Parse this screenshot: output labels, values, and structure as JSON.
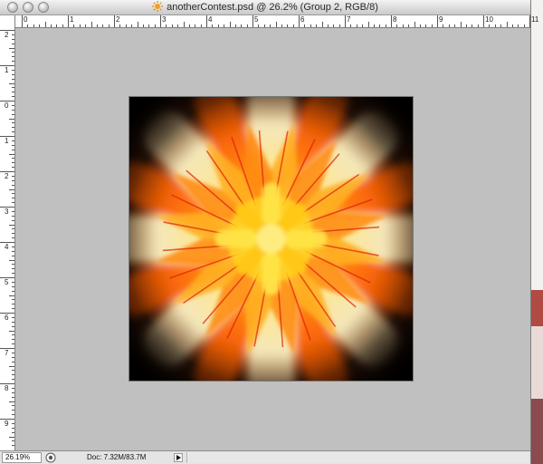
{
  "window": {
    "title": "anotherContest.psd @ 26.2% (Group 2, RGB/8)",
    "document_icon": "photoshop-document-icon",
    "traffic_lights": [
      "close-button",
      "minimize-button",
      "zoom-button"
    ]
  },
  "rulers": {
    "top_labels": [
      "0",
      "1",
      "2",
      "3",
      "4",
      "5",
      "6",
      "7",
      "8",
      "9",
      "10",
      "11"
    ],
    "left_labels": [
      "2",
      "1",
      "0",
      "1",
      "2",
      "3",
      "4",
      "5",
      "6",
      "7",
      "8",
      "9"
    ]
  },
  "canvas": {
    "background_color": "#c0c0c0",
    "artwork": "kaleidoscope-flower-image"
  },
  "status": {
    "zoom": "26.19%",
    "doc_info": "Doc: 7.32M/83.7M",
    "status_icon": "quick-mask-icon",
    "menu_arrow_icon": "triangle-right-icon"
  }
}
